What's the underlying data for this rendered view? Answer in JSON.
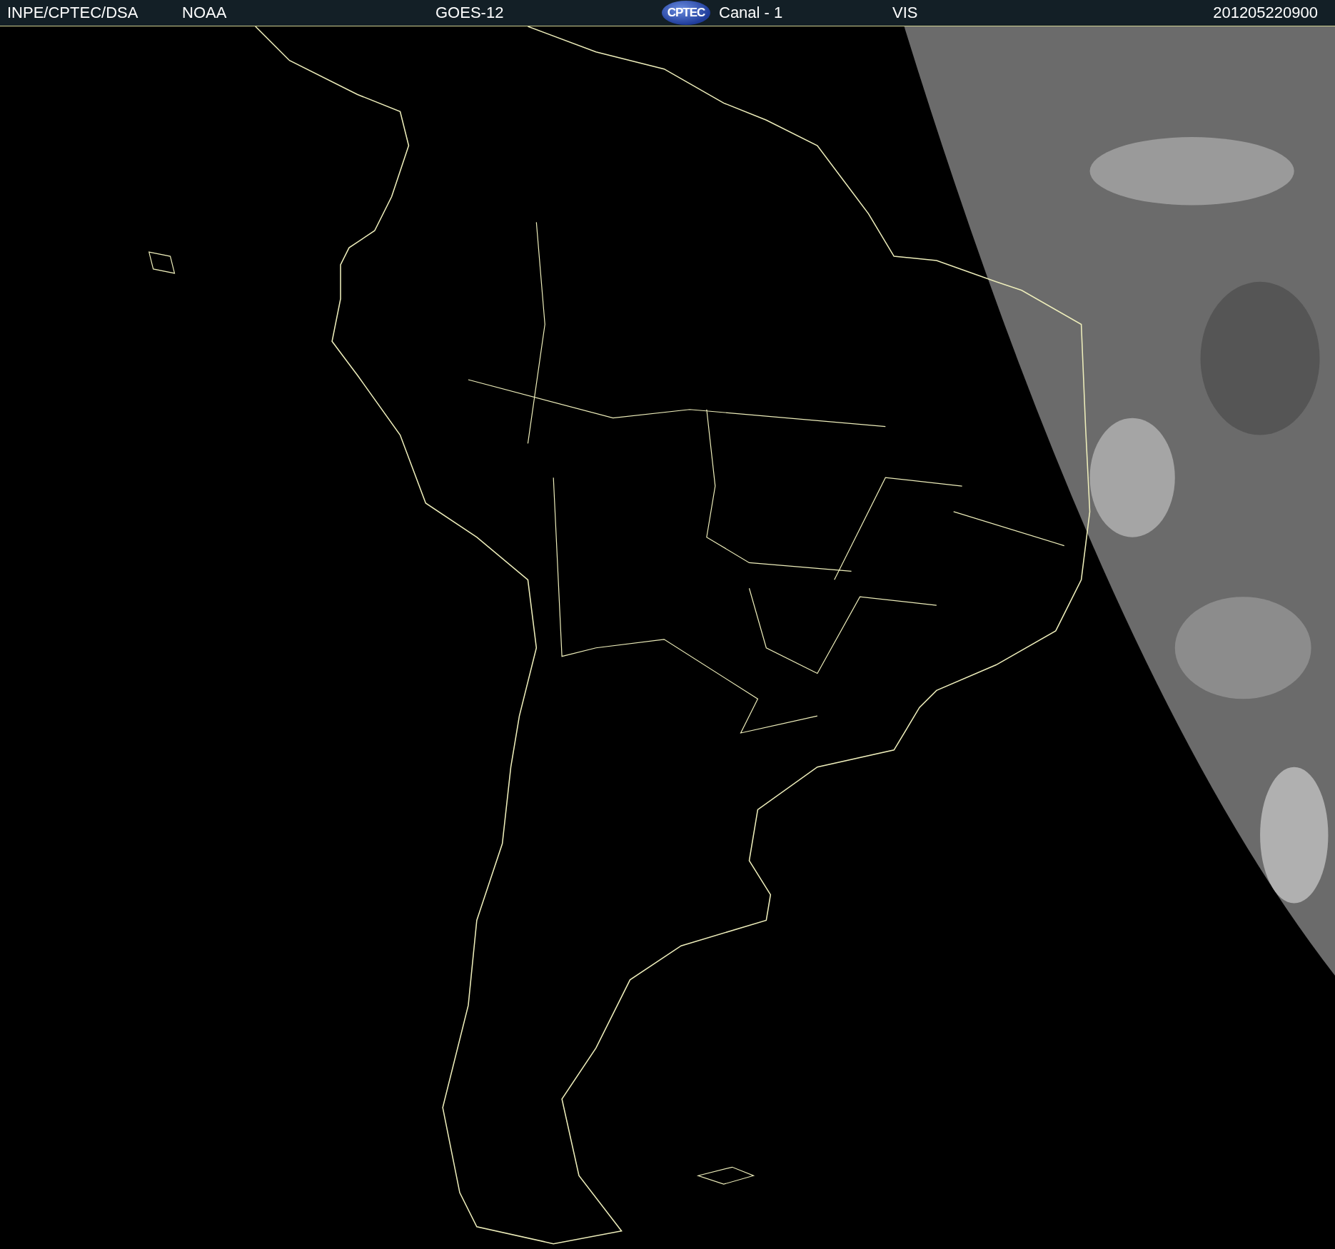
{
  "header": {
    "source": "INPE/CPTEC/DSA",
    "agency": "NOAA",
    "satellite": "GOES-12",
    "logo_text": "CPTEC",
    "channel": "Canal - 1",
    "band": "VIS",
    "timestamp": "201205220900"
  }
}
